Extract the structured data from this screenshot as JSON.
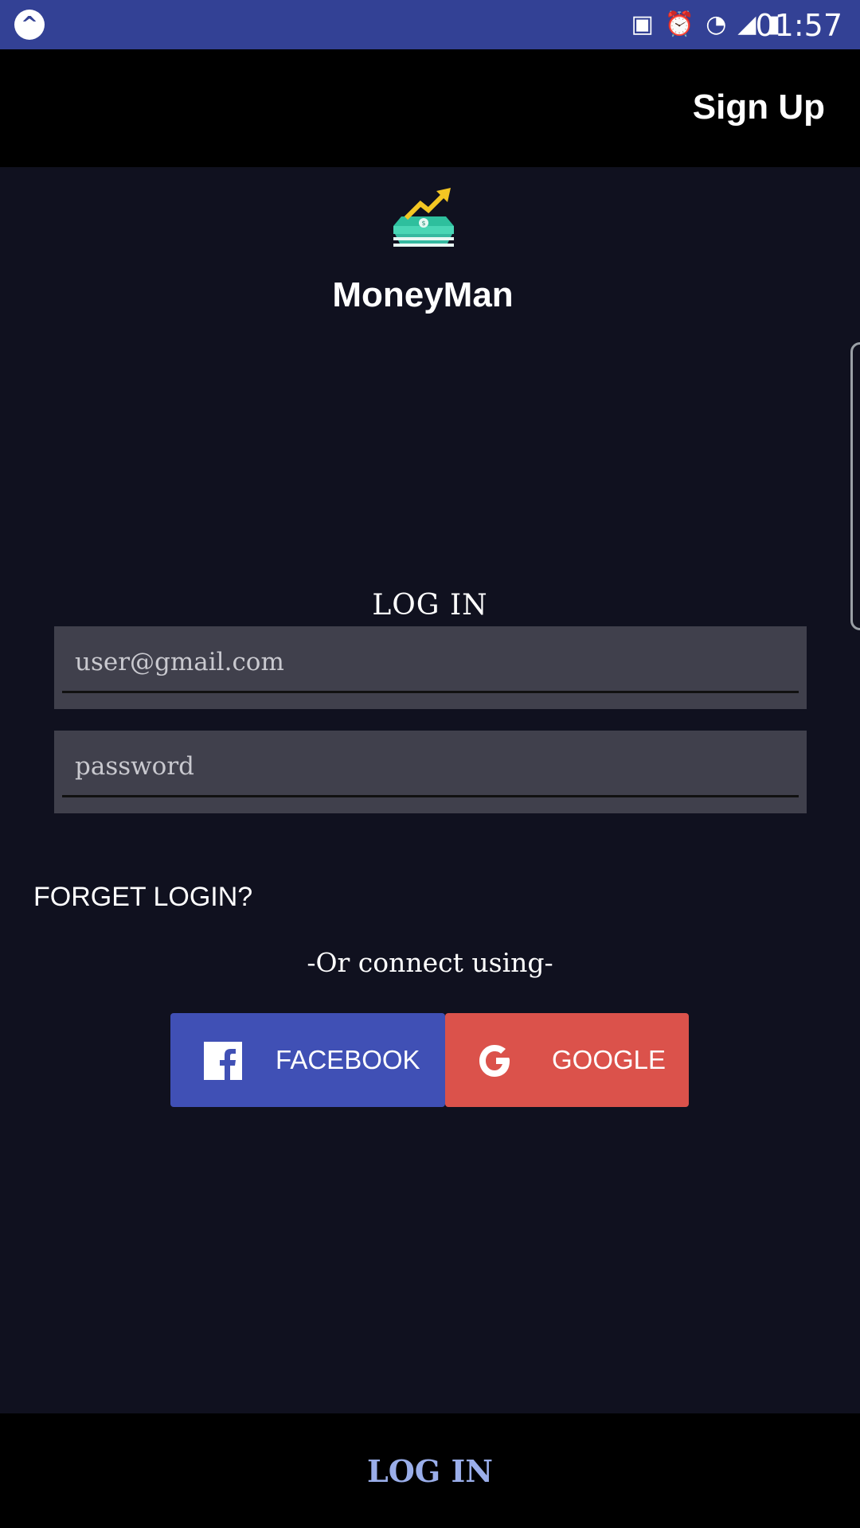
{
  "status_bar": {
    "time": "01:57",
    "icons": [
      "app-logo-icon",
      "battery-saver-icon",
      "alarm-icon",
      "wifi-icon",
      "signal-icon",
      "battery-charging-icon"
    ]
  },
  "app_bar": {
    "sign_up_label": "Sign Up"
  },
  "branding": {
    "app_name": "MoneyMan",
    "logo_icon": "money-growth-icon"
  },
  "login_form": {
    "title": "LOG IN",
    "email_placeholder": "user@gmail.com",
    "password_placeholder": "password",
    "forget_label": "FORGET LOGIN?",
    "connect_text": "-Or connect using-"
  },
  "social": {
    "facebook_label": "FACEBOOK",
    "google_label": "GOOGLE",
    "facebook_color": "#4050b5",
    "google_color": "#db524b"
  },
  "bottom_bar": {
    "login_label": "LOG IN"
  },
  "colors": {
    "status_bar": "#334195",
    "background": "#10111f",
    "field": "#40404c"
  }
}
